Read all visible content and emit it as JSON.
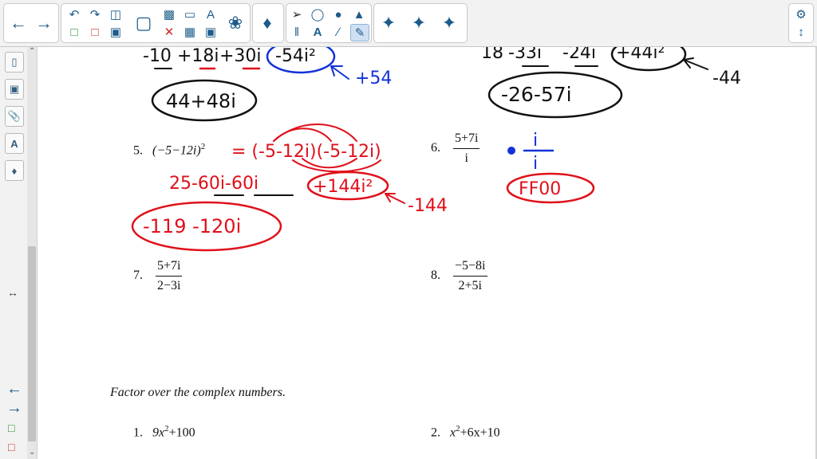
{
  "toolbar": {
    "icons": [
      "back-arrow",
      "forward-arrow",
      "undo",
      "redo",
      "clipboard",
      "add-page",
      "delete-page",
      "save",
      "screen-capture",
      "paste",
      "delete",
      "table",
      "fill-screen",
      "activity-builder",
      "addons",
      "select",
      "shapes",
      "fill",
      "eraser",
      "pens",
      "text",
      "line",
      "highlighter",
      "magic-pen-1",
      "magic-pen-2",
      "magic-pen-3",
      "settings",
      "expand-toolbar"
    ]
  },
  "sidebar": {
    "tabs": [
      "page-sorter",
      "gallery",
      "attachments",
      "properties",
      "addons"
    ]
  },
  "ink": {
    "problem4_left": {
      "terms": [
        "-10",
        "+18i",
        "+30i",
        "-54i²"
      ],
      "note": "+54",
      "answer": "44+48i"
    },
    "problem4_right": {
      "terms": [
        "18",
        "-33i",
        "-24i",
        "+44i²"
      ],
      "note": "-44",
      "answer": "-26-57i"
    },
    "problem5": {
      "expansion": "= (-5-12i)(-5-12i)",
      "step": "25-60i-60i",
      "box": "+144i²",
      "note": "-144",
      "answer": "-119 -120i"
    },
    "problem6": {
      "multiplier_num": "i",
      "multiplier_den": "i",
      "answer": "FF00"
    }
  },
  "worksheet": {
    "p5": {
      "num": "5.",
      "expr": "(−5−12i)",
      "exp": "2"
    },
    "p6": {
      "num": "6.",
      "n": "5+7i",
      "d": "i"
    },
    "p7": {
      "num": "7.",
      "n": "5+7i",
      "d": "2−3i"
    },
    "p8": {
      "num": "8.",
      "n": "−5−8i",
      "d": "2+5i"
    },
    "section_title": "Factor over the complex numbers.",
    "f1": {
      "num": "1.",
      "a": "9x",
      "exp": "2",
      "b": "+100"
    },
    "f2": {
      "num": "2.",
      "a": "x",
      "exp": "2",
      "b": "+6x+10"
    }
  },
  "colors": {
    "red": "#e0101a",
    "blue": "#1232d8",
    "black": "#111111",
    "toolbar_icon": "#1d5c8a"
  }
}
